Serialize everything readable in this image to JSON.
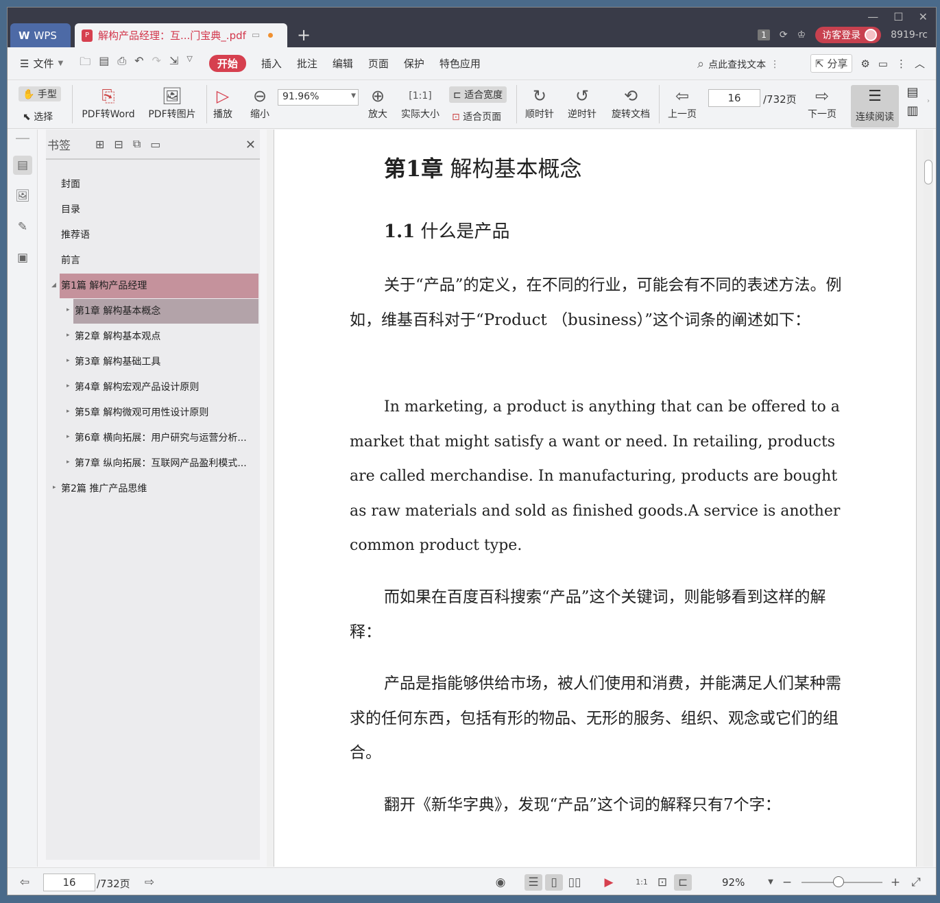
{
  "titlebar": {
    "wps_tab": "WPS",
    "doc_tab": "解构产品经理：互...门宝典_.pdf",
    "page_badge": "1",
    "login": "访客登录",
    "user": "8919-rc"
  },
  "menubar": {
    "file": "文件",
    "tabs": [
      "开始",
      "插入",
      "批注",
      "编辑",
      "页面",
      "保护",
      "特色应用"
    ],
    "search": "点此查找文本",
    "share": "分享"
  },
  "toolbar": {
    "hand": "手型",
    "select": "选择",
    "pdf_to_word": "PDF转Word",
    "pdf_to_image": "PDF转图片",
    "play": "播放",
    "zoom_out": "缩小",
    "zoom_value": "91.96%",
    "zoom_in": "放大",
    "actual_size": "实际大小",
    "fit_width": "适合宽度",
    "fit_page": "适合页面",
    "clockwise": "顺时针",
    "counterclockwise": "逆时针",
    "rotate_doc": "旋转文档",
    "prev_page": "上一页",
    "page_current": "16",
    "page_total": "/732页",
    "next_page": "下一页",
    "continuous": "连续阅读"
  },
  "bookmarks": {
    "title": "书签",
    "items": [
      {
        "label": "封面"
      },
      {
        "label": "目录"
      },
      {
        "label": "推荐语"
      },
      {
        "label": "前言"
      },
      {
        "label": "第1篇 解构产品经理"
      },
      {
        "label": "第1章 解构基本概念"
      },
      {
        "label": "第2章 解构基本观点"
      },
      {
        "label": "第3章 解构基础工具"
      },
      {
        "label": "第4章 解构宏观产品设计原则"
      },
      {
        "label": "第5章 解构微观可用性设计原则"
      },
      {
        "label": "第6章 横向拓展：用户研究与运营分析..."
      },
      {
        "label": "第7章 纵向拓展：互联网产品盈利模式..."
      },
      {
        "label": "第2篇 推广产品思维"
      }
    ]
  },
  "document": {
    "chapter_num": "第1章",
    "chapter_title": " 解构基本概念",
    "section_num": "1.1",
    "section_title": " 什么是产品",
    "paragraphs": [
      "关于“产品”的定义，在不同的行业，可能会有不同的表述方法。例如，维基百科对于“Product （business）”这个词条的阐述如下：",
      "In marketing, a product is anything that can be offered to a market that might satisfy a want or need. In retailing, products are called merchandise. In manufacturing, products are bought as raw materials and sold as finished goods.A service is another common product type.",
      "而如果在百度百科搜索“产品”这个关键词，则能够看到这样的解释：",
      "产品是指能够供给市场，被人们使用和消费，并能满足人们某种需求的任何东西，包括有形的物品、无形的服务、组织、观念或它们的组合。",
      "翻开《新华字典》，发现“产品”这个词的解释只有7个字："
    ]
  },
  "statusbar": {
    "page_current": "16",
    "page_total": "/732页",
    "zoom": "92%"
  }
}
